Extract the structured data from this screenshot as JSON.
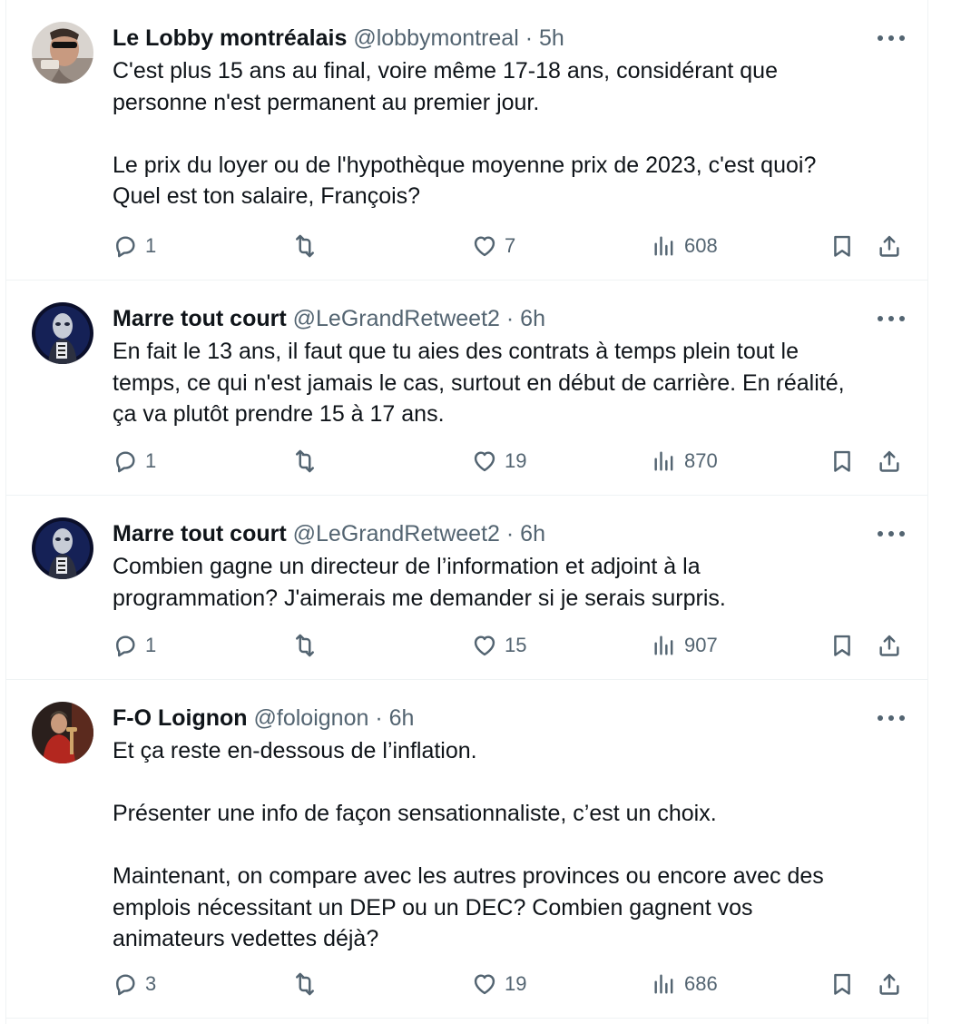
{
  "tweets": [
    {
      "name": "Le Lobby montréalais",
      "handle": "@lobbymontreal",
      "dot": "·",
      "time": "5h",
      "paragraphs": [
        "C'est plus 15 ans au final, voire même 17-18 ans, considérant que\npersonne n'est permanent au premier jour.",
        "Le prix du loyer ou de l'hypothèque moyenne prix de 2023, c'est quoi?\nQuel est ton salaire, François?"
      ],
      "replies": "1",
      "retweets": "",
      "likes": "7",
      "views": "608"
    },
    {
      "name": "Marre tout court",
      "handle": "@LeGrandRetweet2",
      "dot": "·",
      "time": "6h",
      "paragraphs": [
        "En fait le 13 ans, il faut que tu aies des contrats à temps plein tout le\ntemps, ce qui n'est jamais le cas, surtout en début de carrière.  En réalité,\nça va plutôt prendre 15 à 17 ans."
      ],
      "replies": "1",
      "retweets": "",
      "likes": "19",
      "views": "870"
    },
    {
      "name": "Marre tout court",
      "handle": "@LeGrandRetweet2",
      "dot": "·",
      "time": "6h",
      "paragraphs": [
        "Combien gagne un directeur de l’information et adjoint à la\nprogrammation?  J'aimerais me demander si je serais surpris."
      ],
      "replies": "1",
      "retweets": "",
      "likes": "15",
      "views": "907"
    },
    {
      "name": "F-O Loignon",
      "handle": "@foloignon",
      "dot": "·",
      "time": "6h",
      "paragraphs": [
        "Et ça reste en-dessous de l’inflation.",
        "Présenter une info de façon sensationnaliste, c’est un choix.",
        "Maintenant, on compare avec les autres provinces ou encore avec des\nemplois nécessitant un DEP ou un DEC? Combien gagnent vos\nanimateurs vedettes déjà?"
      ],
      "replies": "3",
      "retweets": "",
      "likes": "19",
      "views": "686"
    }
  ],
  "icons": {
    "more": "more-options-icon",
    "reply": "reply-icon",
    "retweet": "retweet-icon",
    "like": "heart-icon",
    "views": "views-icon",
    "bookmark": "bookmark-icon",
    "share": "share-icon"
  },
  "colors": {
    "text": "#0f1419",
    "secondary": "#536471",
    "border": "#eff3f4"
  }
}
